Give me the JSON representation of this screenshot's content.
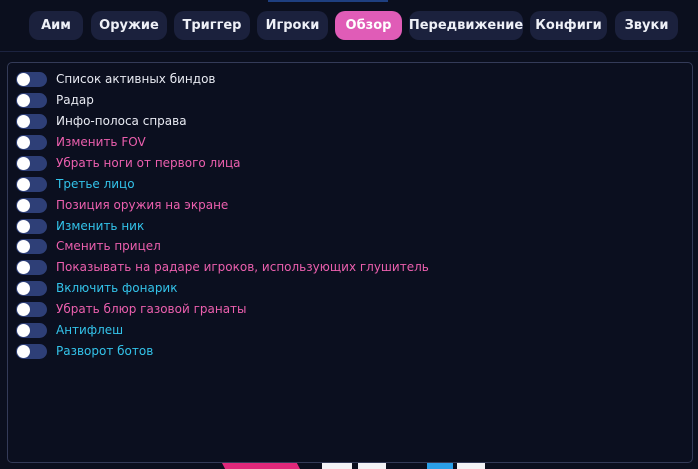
{
  "tabs": [
    {
      "label": "Аим",
      "active": false
    },
    {
      "label": "Оружие",
      "active": false
    },
    {
      "label": "Триггер",
      "active": false
    },
    {
      "label": "Игроки",
      "active": false
    },
    {
      "label": "Обзор",
      "active": true
    },
    {
      "label": "Передвижение",
      "active": false
    },
    {
      "label": "Конфиги",
      "active": false
    },
    {
      "label": "Звуки",
      "active": false
    }
  ],
  "options": [
    {
      "label": "Список активных биндов",
      "enabled": false,
      "color": "white"
    },
    {
      "label": "Радар",
      "enabled": false,
      "color": "white"
    },
    {
      "label": "Инфо-полоса справа",
      "enabled": false,
      "color": "white"
    },
    {
      "label": "Изменить FOV",
      "enabled": false,
      "color": "pink"
    },
    {
      "label": "Убрать ноги от первого лица",
      "enabled": false,
      "color": "pink"
    },
    {
      "label": "Третье лицо",
      "enabled": false,
      "color": "cyan"
    },
    {
      "label": "Позиция оружия на экране",
      "enabled": false,
      "color": "pink"
    },
    {
      "label": "Изменить ник",
      "enabled": false,
      "color": "cyan"
    },
    {
      "label": "Сменить прицел",
      "enabled": false,
      "color": "pink"
    },
    {
      "label": "Показывать на радаре игроков, использующих глушитель",
      "enabled": false,
      "color": "pink"
    },
    {
      "label": "Включить фонарик",
      "enabled": false,
      "color": "cyan"
    },
    {
      "label": "Убрать блюр газовой гранаты",
      "enabled": false,
      "color": "pink"
    },
    {
      "label": "Антифлеш",
      "enabled": false,
      "color": "cyan"
    },
    {
      "label": "Разворот ботов",
      "enabled": false,
      "color": "cyan"
    }
  ],
  "colors": {
    "background": "#0b0f1e",
    "tab": "#1b213d",
    "tab_active": "#e05cb7",
    "toggle_off": "#2e3f77",
    "text_white": "#e8eaf2",
    "text_pink": "#ec5fae",
    "text_cyan": "#33c3ea"
  }
}
